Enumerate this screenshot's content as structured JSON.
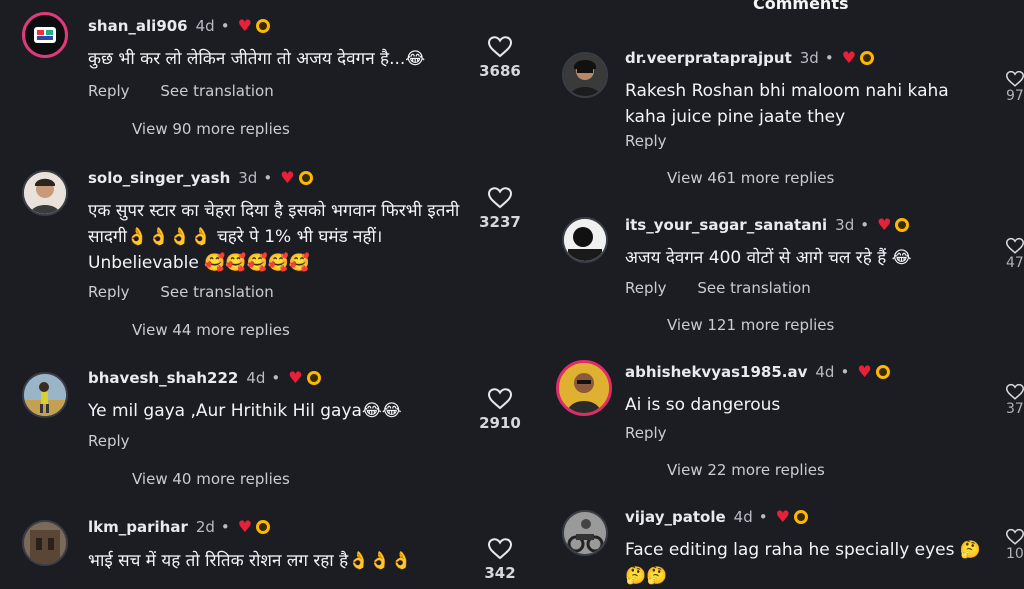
{
  "header": {
    "title": "Comments"
  },
  "left_comments": [
    {
      "user": "shan_ali906",
      "time": "4d",
      "text": "कुछ भी कर लो लेकिन जीतेगा तो अजय देवगन है...😂",
      "actions": [
        "Reply",
        "See translation"
      ],
      "more": "View 90 more replies",
      "likes": "3686"
    },
    {
      "user": "solo_singer_yash",
      "time": "3d",
      "text": "एक सुपर स्टार का चेहरा दिया है इसको भगवान फिरभी इतनी सादगी👌👌👌👌 चहरे पे 1% भी घमंड नहीं। Unbelievable 🥰🥰🥰🥰🥰",
      "actions": [
        "Reply",
        "See translation"
      ],
      "more": "View 44 more replies",
      "likes": "3237"
    },
    {
      "user": "bhavesh_shah222",
      "time": "4d",
      "text": "Ye mil gaya ,Aur Hrithik Hil gaya😂😂",
      "actions": [
        "Reply"
      ],
      "more": "View 40 more replies",
      "likes": "2910"
    },
    {
      "user": "lkm_parihar",
      "time": "2d",
      "text": "भाई सच में यह तो रितिक रोशन लग रहा है👌👌👌",
      "actions": [],
      "more": "",
      "likes": "342"
    }
  ],
  "right_comments": [
    {
      "user": "dr.veerprataprajput",
      "time": "3d",
      "text": "Rakesh Roshan bhi maloom nahi kaha kaha juice pine jaate they",
      "actions": [
        "Reply"
      ],
      "more": "View 461 more replies"
    },
    {
      "user": "its_your_sagar_sanatani",
      "time": "3d",
      "text": "अजय देवगन 400 वोटों से आगे चल रहे हैं 😂",
      "actions": [
        "Reply",
        "See translation"
      ],
      "more": "View 121 more replies"
    },
    {
      "user": "abhishekvyas1985.av",
      "time": "4d",
      "text": "Ai is so dangerous",
      "actions": [
        "Reply"
      ],
      "more": "View 22 more replies"
    },
    {
      "user": "vijay_patole",
      "time": "4d",
      "text": "Face editing lag raha he specially eyes 🤔 🤔🤔",
      "actions": [],
      "more": ""
    }
  ],
  "right_edge_counts": [
    "97",
    "47",
    "37",
    "10"
  ],
  "colors": {
    "background": "#1b1d23",
    "heart": "#e8203a",
    "story_ring": "#e13a7c",
    "badge": "#ffb800"
  },
  "icons": {
    "like": "heart-outline-icon",
    "liked_by_author": "heart-filled-icon",
    "badge": "creator-badge-icon"
  }
}
